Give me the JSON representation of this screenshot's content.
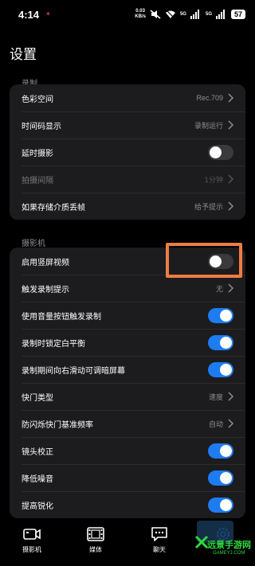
{
  "status_bar": {
    "time": "4:14",
    "net_speed_value": "0.03",
    "net_speed_unit": "KB/s",
    "signal1": "5G",
    "signal2": "5G",
    "battery": "57"
  },
  "page": {
    "title": "设置"
  },
  "sections": {
    "record": {
      "label": "录制",
      "rows": [
        {
          "label": "色彩空间",
          "value": "Rec.709"
        },
        {
          "label": "时间码显示",
          "value": "录制运行"
        },
        {
          "label": "延时摄影",
          "toggle": "off"
        },
        {
          "label": "拍摄间隔",
          "value": "1分钟"
        },
        {
          "label": "如果存储介质丢帧",
          "value": "给予提示"
        }
      ]
    },
    "camera": {
      "label": "摄影机",
      "rows": [
        {
          "label": "启用竖屏视频",
          "toggle": "off"
        },
        {
          "label": "触发录制提示",
          "value": "无"
        },
        {
          "label": "使用音量按钮触发录制",
          "toggle": "on"
        },
        {
          "label": "录制时锁定白平衡",
          "toggle": "on"
        },
        {
          "label": "录制期间向右滑动可调暗屏幕",
          "toggle": "on"
        },
        {
          "label": "快门类型",
          "value": "速度"
        },
        {
          "label": "防闪烁快门基准频率",
          "value": "自动"
        },
        {
          "label": "镜头校正",
          "toggle": "on"
        },
        {
          "label": "降低噪音",
          "toggle": "on"
        },
        {
          "label": "提高锐化",
          "toggle": "on"
        }
      ]
    }
  },
  "tabs": [
    {
      "label": "摄影机",
      "icon": "camera-icon"
    },
    {
      "label": "媒体",
      "icon": "film-icon"
    },
    {
      "label": "聊天",
      "icon": "chat-icon"
    },
    {
      "label": "",
      "icon": "gear-icon"
    }
  ],
  "watermark": {
    "text": "远景手游网",
    "sub": "GAMEYJ.COM"
  },
  "colors": {
    "accent_toggle": "#1e7cf2",
    "highlight": "#ee7c44",
    "card_bg": "#1c1c1e"
  }
}
